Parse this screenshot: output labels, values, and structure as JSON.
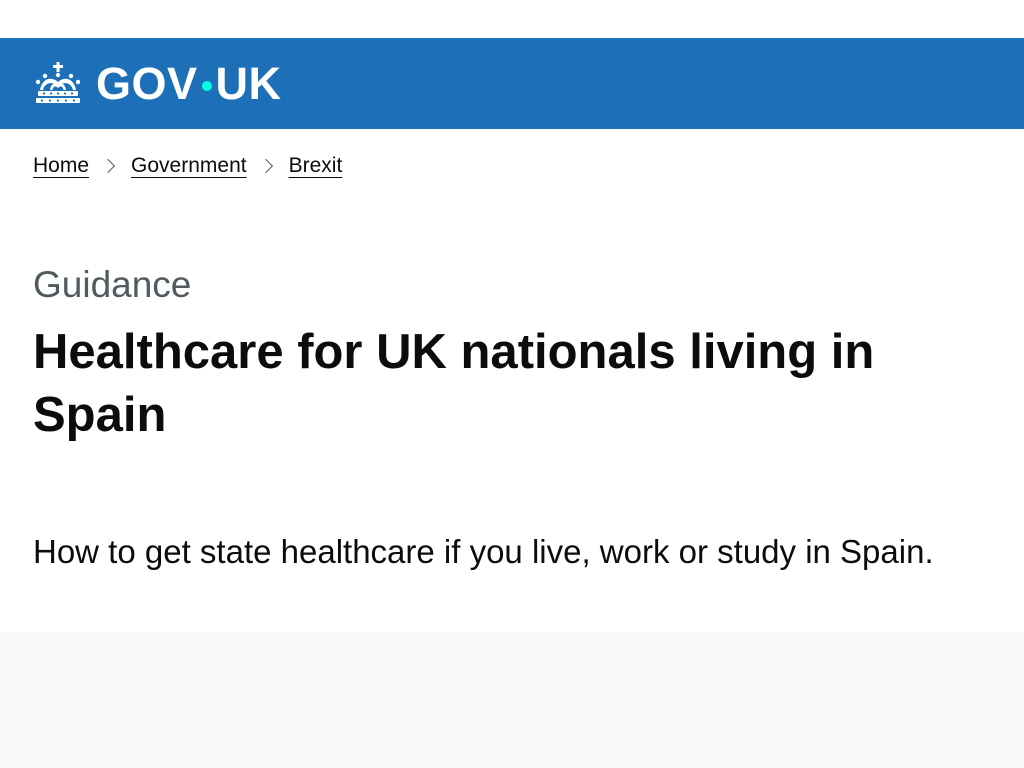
{
  "header": {
    "logo_part1": "GOV",
    "logo_part2": "UK",
    "crown_icon": "crown-icon",
    "background_color": "#1d70b8",
    "dot_color": "#00ffe0"
  },
  "breadcrumbs": [
    {
      "label": "Home"
    },
    {
      "label": "Government"
    },
    {
      "label": "Brexit"
    }
  ],
  "page": {
    "caption": "Guidance",
    "title": "Healthcare for UK nationals living in Spain",
    "lead": "How to get state healthcare if you live, work or study in Spain."
  }
}
